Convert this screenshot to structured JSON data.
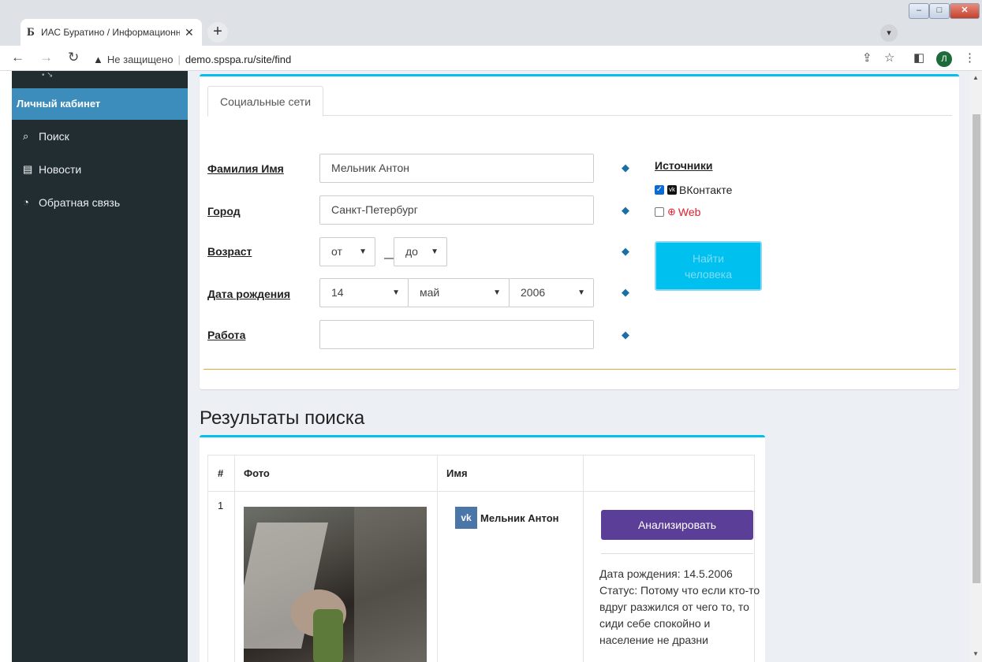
{
  "browser": {
    "tab_favicon": "Б",
    "tab_title": "ИАС Буратино / Информационн",
    "tab_close": "✕",
    "new_tab": "+",
    "security_label": "Не защищено",
    "url": "demo.spspa.ru/site/find",
    "profile_initial": "Л"
  },
  "sidebar": {
    "cabinet_label": "Личный кабинет",
    "items": [
      {
        "label": "Поиск",
        "icon": "search-icon"
      },
      {
        "label": "Новости",
        "icon": "newspaper-icon"
      },
      {
        "label": "Обратная связь",
        "icon": "rss-icon"
      }
    ]
  },
  "search_form": {
    "tab_label": "Социальные сети",
    "name_label": "Фамилия Имя",
    "name_value": "Мельник Антон",
    "city_label": "Город",
    "city_value": "Санкт-Петербург",
    "age_label": "Возраст",
    "age_from": "от",
    "age_to": "до",
    "birth_label": "Дата рождения",
    "birth_day": "14",
    "birth_month": "май",
    "birth_year": "2006",
    "work_label": "Работа",
    "work_value": "",
    "sources_label": "Источники",
    "source_vk": "ВКонтакте",
    "source_vk_checked": true,
    "source_web": "Web",
    "source_web_checked": false,
    "find_line1": "Найти",
    "find_line2": "человека"
  },
  "results": {
    "title": "Результаты поиска",
    "columns": [
      "#",
      "Фото",
      "Имя",
      ""
    ],
    "rows": [
      {
        "num": "1",
        "name": "Мельник Антон",
        "analyze_label": "Анализировать",
        "birth": "Дата рождения: 14.5.2006",
        "status": "Статус: Потому что если кто-то вдруг разжился от чего то, то сиди себе спокойно и население не дразни"
      }
    ]
  },
  "colors": {
    "accent": "#00c0ef",
    "sidebar_bg": "#222d32",
    "active_item": "#3c8dbc",
    "analyze_button": "#5a3e98",
    "vk_brand": "#4a76a8"
  }
}
